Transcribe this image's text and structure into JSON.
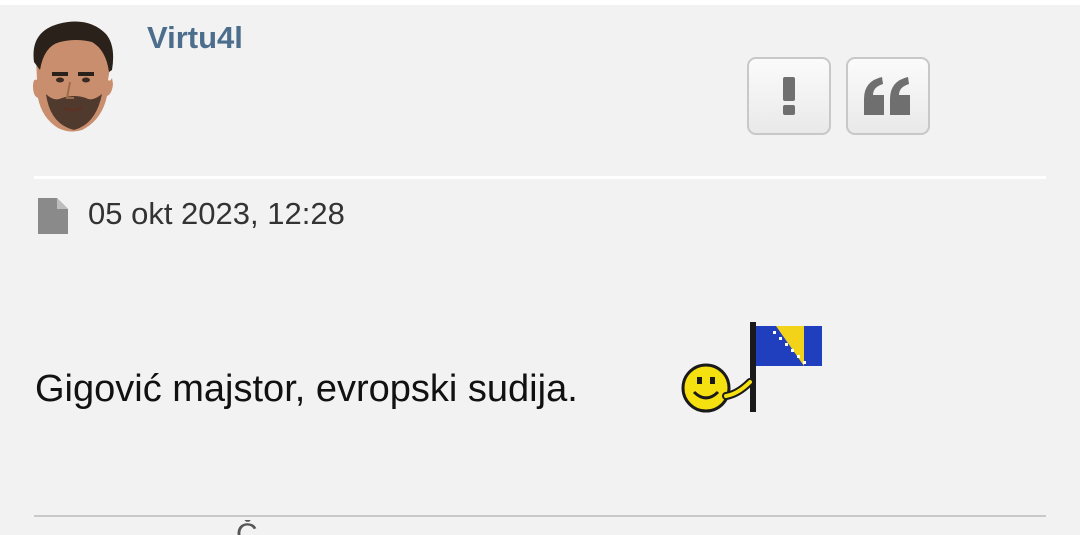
{
  "post": {
    "author": "Virtu4l",
    "date": "05 okt 2023, 12:28",
    "text": "Gigović majstor, evropski sudija.",
    "avatar_icon": "user-avatar-photo",
    "actions": {
      "report_label": "!",
      "quote_label": "❝",
      "report_icon": "exclamation-icon",
      "quote_icon": "quote-icon"
    },
    "date_icon": "file-icon",
    "emoticon": "smiley-with-bosnia-flag",
    "next_post_hint": "Č"
  },
  "colors": {
    "background": "#f2f2f2",
    "username": "#4c6d8c",
    "text": "#111111",
    "button_border": "#c8c8c8"
  }
}
